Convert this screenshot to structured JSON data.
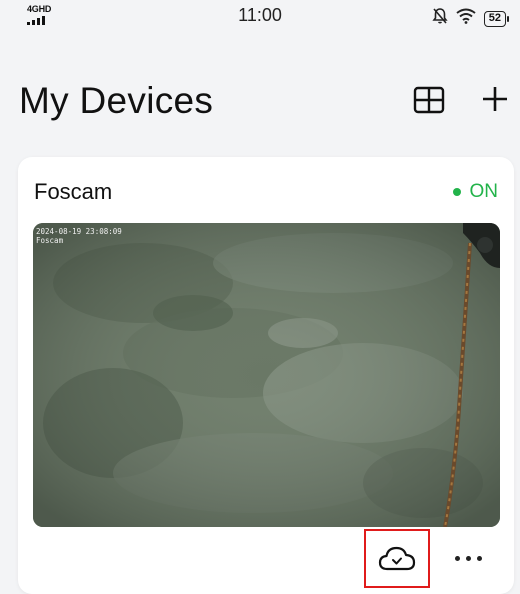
{
  "status_bar": {
    "network": "4GHD",
    "time": "11:00",
    "battery": "52"
  },
  "header": {
    "title": "My Devices"
  },
  "device": {
    "name": "Foscam",
    "status": "ON",
    "status_color": "#22b34a",
    "preview_timestamp": "2024-08-19 23:08:09",
    "preview_label": "Foscam"
  },
  "icons": {
    "layout": "grid-icon",
    "add": "plus-icon",
    "cloud": "cloud-check-icon",
    "more": "more-dots-icon"
  }
}
